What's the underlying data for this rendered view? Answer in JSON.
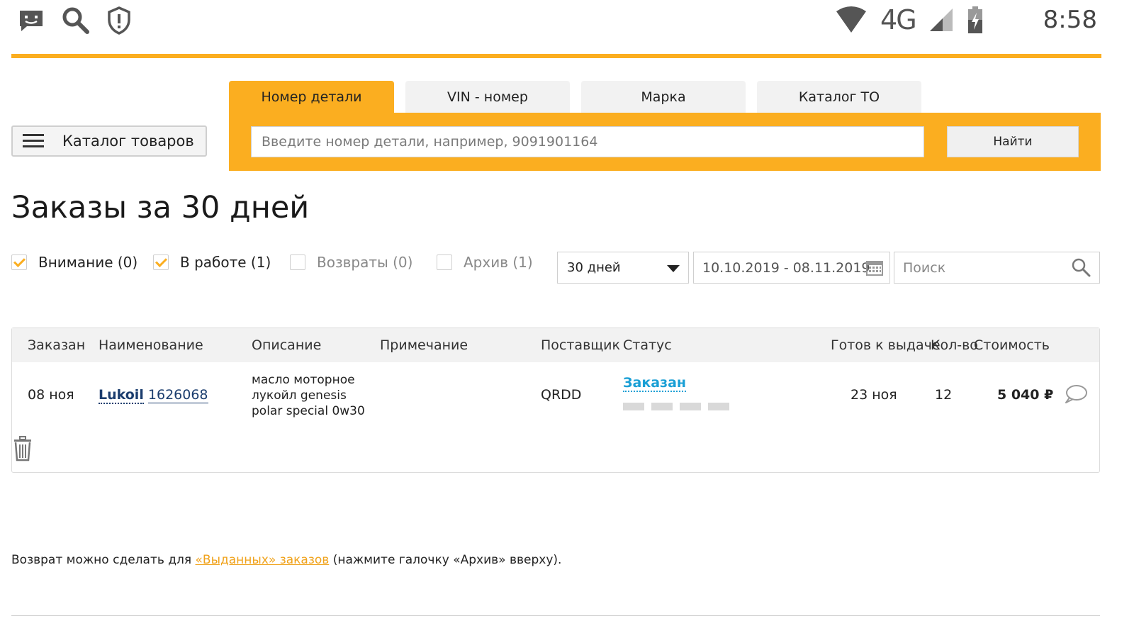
{
  "statusbar": {
    "network": "4G",
    "time": "8:58",
    "icons": [
      "message-icon",
      "search-icon",
      "shield-alert-icon",
      "wifi-icon",
      "signal-icon",
      "battery-charging-icon"
    ]
  },
  "catalog_button": {
    "label": "Каталог товаров"
  },
  "tabs": [
    {
      "label": "Номер детали",
      "active": true
    },
    {
      "label": "VIN - номер",
      "active": false
    },
    {
      "label": "Марка",
      "active": false
    },
    {
      "label": "Каталог ТО",
      "active": false
    }
  ],
  "search": {
    "placeholder": "Введите номер детали, например, 9091901164",
    "button": "Найти"
  },
  "page_title": "Заказы за 30 дней",
  "filters": [
    {
      "label": "Внимание (0)",
      "checked": true
    },
    {
      "label": "В работе (1)",
      "checked": true
    },
    {
      "label": "Возвраты (0)",
      "checked": false
    },
    {
      "label": "Архив (1)",
      "checked": false
    }
  ],
  "period_select": {
    "value": "30 дней"
  },
  "date_range": "10.10.2019 - 08.11.2019",
  "table_search": {
    "placeholder": "Поиск"
  },
  "table": {
    "headers": [
      "Заказан",
      "Наименование",
      "Описание",
      "Примечание",
      "Поставщик",
      "Статус",
      "Готов к выдаче",
      "Кол-во",
      "Стоимость"
    ],
    "rows": [
      {
        "ordered": "08 ноя",
        "brand": "Lukoil",
        "part_number": "1626068",
        "description_lines": [
          "масло моторное",
          "лукойл genesis",
          "polar special 0w30"
        ],
        "note": "",
        "supplier": "QRDD",
        "status": "Заказан",
        "ready": "23 ноя",
        "qty": "12",
        "cost": "5 040 ₽"
      }
    ]
  },
  "footer_note": {
    "before": "Возврат можно сделать для ",
    "link": "«Выданных» заказов",
    "after": " (нажмите галочку «Архив» вверху)."
  },
  "colors": {
    "accent": "#fbae20",
    "link_dark": "#1b3d6e",
    "status_blue": "#1a9fd5",
    "footer_link": "#f0a21a"
  }
}
